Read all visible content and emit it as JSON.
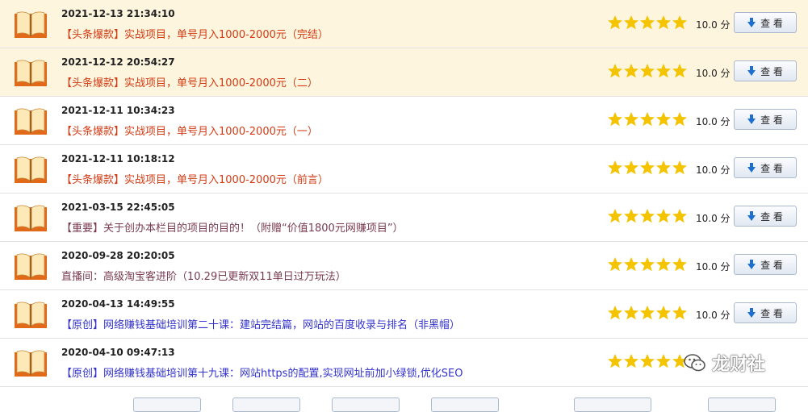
{
  "items": [
    {
      "date": "2021-12-13 21:34:10",
      "title": "【头条爆款】实战项目，单号月入1000-2000元（完结）",
      "title_color": "#d23b14",
      "score": "10.0 分",
      "button": "查 看",
      "highlight": true
    },
    {
      "date": "2021-12-12 20:54:27",
      "title": "【头条爆款】实战项目，单号月入1000-2000元（二）",
      "title_color": "#d23b14",
      "score": "10.0 分",
      "button": "查 看",
      "highlight": true
    },
    {
      "date": "2021-12-11 10:34:23",
      "title": "【头条爆款】实战项目，单号月入1000-2000元（一）",
      "title_color": "#d23b14",
      "score": "10.0 分",
      "button": "查 看",
      "highlight": false
    },
    {
      "date": "2021-12-11 10:18:12",
      "title": "【头条爆款】实战项目，单号月入1000-2000元（前言）",
      "title_color": "#d23b14",
      "score": "10.0 分",
      "button": "查 看",
      "highlight": false
    },
    {
      "date": "2021-03-15 22:45:05",
      "title": "【重要】关于创办本栏目的项目的目的！（附赠“价值1800元网赚项目”）",
      "title_color": "#7a3b52",
      "score": "10.0 分",
      "button": "查 看",
      "highlight": false
    },
    {
      "date": "2020-09-28 20:20:05",
      "title": "直播间：高级淘宝客进阶（10.29已更新双11单日过万玩法）",
      "title_color": "#7a3b52",
      "score": "10.0 分",
      "button": "查 看",
      "highlight": false
    },
    {
      "date": "2020-04-13 14:49:55",
      "title": "【原创】网络赚钱基础培训第二十课：建站完结篇，网站的百度收录与排名（非黑帽）",
      "title_color": "#3333cc",
      "score": "10.0 分",
      "button": "查 看",
      "highlight": false
    },
    {
      "date": "2020-04-10 09:47:13",
      "title": "【原创】网络赚钱基础培训第十九课：网站https的配置,实现网址前加小绿锁,优化SEO",
      "title_color": "#3333cc",
      "score": "",
      "button": "",
      "highlight": false
    }
  ],
  "rating_stars": 5,
  "star_color": "#f5c400",
  "watermark": {
    "text": "龙财社",
    "icon": "wechat-icon"
  }
}
